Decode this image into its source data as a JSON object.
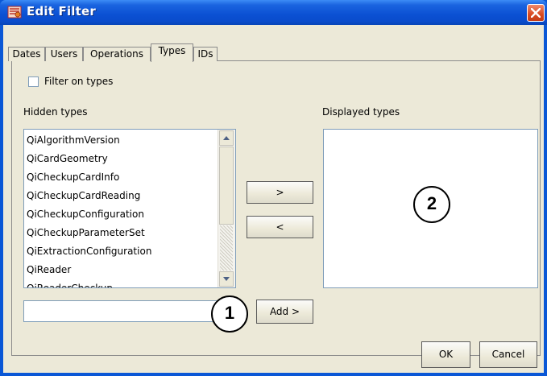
{
  "window": {
    "title": "Edit Filter",
    "title_bar_color": "#0a57d6",
    "close_icon": "close-icon"
  },
  "tabs": [
    {
      "label": "Dates",
      "active": false
    },
    {
      "label": "Users",
      "active": false
    },
    {
      "label": "Operations",
      "active": false
    },
    {
      "label": "Types",
      "active": true
    },
    {
      "label": "IDs",
      "active": false
    }
  ],
  "filter_checkbox": {
    "label": "Filter on types",
    "checked": false
  },
  "hidden_types": {
    "label": "Hidden types",
    "items": [
      "QiAlgorithmVersion",
      "QiCardGeometry",
      "QiCheckupCardInfo",
      "QiCheckupCardReading",
      "QiCheckupConfiguration",
      "QiCheckupParameterSet",
      "QiExtractionConfiguration",
      "QiReader",
      "QiReaderCheckup"
    ]
  },
  "displayed_types": {
    "label": "Displayed types",
    "items": []
  },
  "buttons": {
    "move_right": ">",
    "move_left": "<",
    "add": "Add >",
    "ok": "OK",
    "cancel": "Cancel"
  },
  "new_type_input": {
    "value": "",
    "placeholder": ""
  },
  "callouts": [
    "1",
    "2"
  ]
}
